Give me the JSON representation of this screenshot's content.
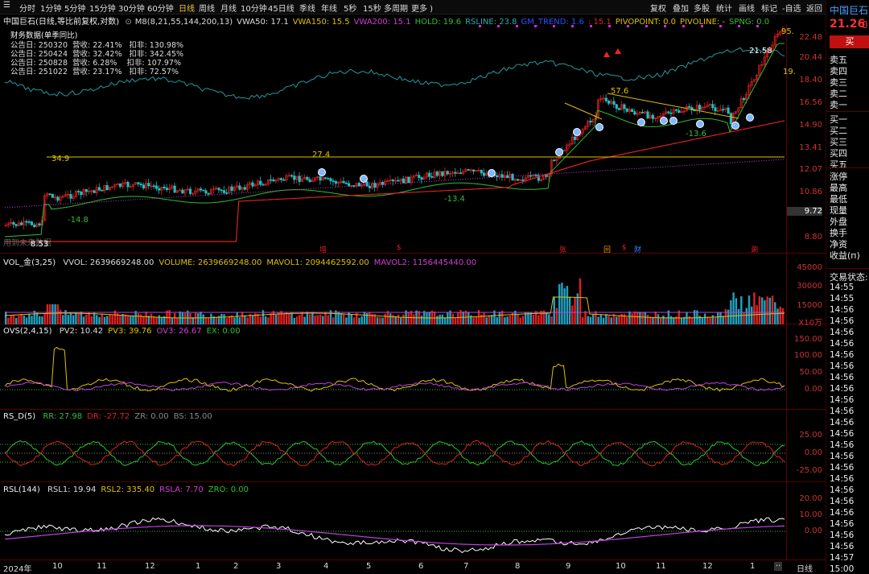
{
  "toolbar": {
    "periods": [
      "分时",
      "1分钟",
      "5分钟",
      "15分钟",
      "30分钟",
      "60分钟",
      "日线",
      "周线",
      "月线",
      "10分钟",
      "45日线",
      "季线",
      "年线",
      "5秒",
      "15秒",
      "多周期",
      "更多 )"
    ],
    "active_period": "日线",
    "right_items": [
      "复权",
      "叠加",
      "多股",
      "统计",
      "画线",
      "标记",
      "-自选",
      "返回"
    ]
  },
  "header": {
    "title": "中国巨石(日线,等比前复权,对数)",
    "indicators": [
      {
        "text": "M8(8,21,55,144,200,13)",
        "color": "#dddddd"
      },
      {
        "text": "VWA50: 17.1",
        "color": "#dddddd"
      },
      {
        "text": "VWA150: 15.5",
        "color": "#e0c000"
      },
      {
        "text": "VWA200: 15.1",
        "color": "#d040d0"
      },
      {
        "text": "HOLD: 19.6",
        "color": "#30c030"
      },
      {
        "text": "RSLINE: 23.8",
        "color": "#20b0b0"
      },
      {
        "text": "GM_TREND: 1.6",
        "color": "#3050ff"
      },
      {
        "text": ": 15.1",
        "color": "#e02020"
      },
      {
        "text": "PIVOPOINT: 0.0",
        "color": "#e0c000"
      },
      {
        "text": "PIVOLINE: -",
        "color": "#e0c000"
      },
      {
        "text": "SPNG: 0.0",
        "color": "#30c030"
      }
    ]
  },
  "financial": {
    "title": "财务数据(单季同比)",
    "rows": [
      "公告日: 250320  营收: 22.41%   扣非: 130.98%",
      "公告日: 250424  营收: 32.42%   扣非: 342.45%",
      "公告日: 250828  营收: 6.28%    扣非: 107.97%",
      "公告日: 251022  营收: 23.17%   扣非: 72.57%"
    ]
  },
  "main_chart": {
    "yaxis": [
      "22.48",
      "20.44",
      "18.40",
      "16.56",
      "14.90",
      "13.41",
      "12.07",
      "10.86",
      "9.72",
      "8.80"
    ],
    "annotations": [
      "34.9",
      "-14.8",
      "27.4",
      "-13.4",
      "57.6",
      "-13.6",
      "21.58",
      "95.",
      "19.",
      "8.53"
    ],
    "event_markers": [
      "增",
      "$",
      "张",
      "回",
      "$",
      "财",
      "涮"
    ],
    "watermark": "用到未来数据"
  },
  "volume_panel": {
    "title": "VOL_金(3,25)",
    "values": [
      {
        "text": "VVOL: 2639669248.00",
        "color": "#dddddd"
      },
      {
        "text": "VOLUME: 2639669248.00",
        "color": "#e0c000"
      },
      {
        "text": "MAVOL1: 2094462592.00",
        "color": "#e0c000"
      },
      {
        "text": "MAVOL2: 1156445440.00",
        "color": "#d040d0"
      }
    ],
    "yaxis": [
      "45000",
      "30000",
      "15000"
    ],
    "unit": "X10万"
  },
  "ovs_panel": {
    "title": "OVS(2,4,15)",
    "values": [
      {
        "text": "PV2: 10.42",
        "color": "#dddddd"
      },
      {
        "text": "PV3: 39.76",
        "color": "#e0c000"
      },
      {
        "text": "OV3: 26.67",
        "color": "#d040d0"
      },
      {
        "text": "EX: 0.00",
        "color": "#30c030"
      }
    ],
    "yaxis": [
      "150.00",
      "100.00",
      "50.00",
      "0.00"
    ]
  },
  "rsd_panel": {
    "title": "RS_D(5)",
    "values": [
      {
        "text": "RR: 27.98",
        "color": "#30c030"
      },
      {
        "text": "DR: -27.72",
        "color": "#e02020"
      },
      {
        "text": "ZR: 0.00",
        "color": "#888888"
      },
      {
        "text": "BS: 15.00",
        "color": "#888888"
      }
    ],
    "yaxis": [
      "25.00",
      "0.00",
      "-25.00"
    ]
  },
  "rsl_panel": {
    "title": "RSL(144)",
    "values": [
      {
        "text": "RSL1: 19.94",
        "color": "#dddddd"
      },
      {
        "text": "RSL2: 335.40",
        "color": "#e0c000"
      },
      {
        "text": "RSLA: 7.70",
        "color": "#d040d0"
      },
      {
        "text": "ZRO: 0.00",
        "color": "#30c030"
      }
    ],
    "yaxis": [
      "20.00",
      "10.00",
      "0.00"
    ]
  },
  "xaxis": {
    "labels": [
      "2024年",
      "10",
      "11",
      "12",
      "1",
      "2",
      "3",
      "4",
      "5",
      "6",
      "7",
      "8",
      "9",
      "10",
      "11",
      "12",
      "1"
    ],
    "bottom_right": "日线"
  },
  "quote_panel": {
    "name": "中国巨石",
    "price": "21.26",
    "change": "0.",
    "buy_button": "买",
    "sells": [
      "卖五",
      "卖四",
      "卖三",
      "卖二",
      "卖一"
    ],
    "buys": [
      "买一",
      "买二",
      "买三",
      "买四",
      "买五"
    ],
    "stats": [
      "涨停",
      "最高",
      "最低",
      "现量",
      "外盘",
      "换手",
      "净资",
      "收益(п)"
    ],
    "trade_status": "交易状态:",
    "times": [
      "14:55",
      "14:55",
      "14:56",
      "14:56",
      "14:56",
      "14:56",
      "14:56",
      "14:56",
      "14:56",
      "14:56",
      "14:56",
      "14:56",
      "14:56",
      "14:56",
      "14:56",
      "14:56",
      "14:56",
      "14:56",
      "14:56",
      "14:56",
      "14:56",
      "14:56",
      "14:56",
      "14:56",
      "14:57",
      "15:00"
    ]
  },
  "colors": {
    "up": "#e02020",
    "down": "#20c0c0",
    "yellow": "#e0c000",
    "green": "#30c030",
    "purple": "#c040e0",
    "teal": "#20a0a0"
  }
}
